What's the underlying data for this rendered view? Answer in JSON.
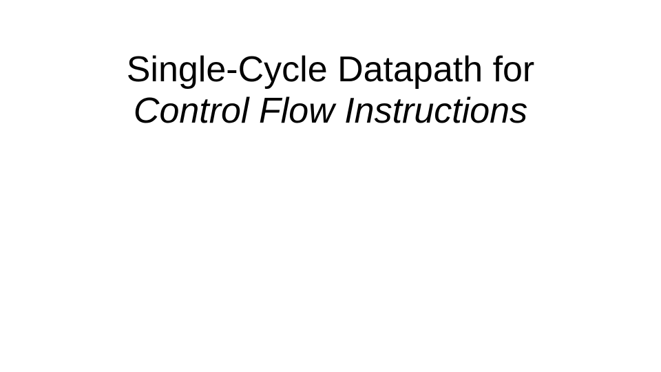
{
  "slide": {
    "title_line1": "Single-Cycle Datapath for",
    "title_line2": "Control Flow Instructions"
  }
}
